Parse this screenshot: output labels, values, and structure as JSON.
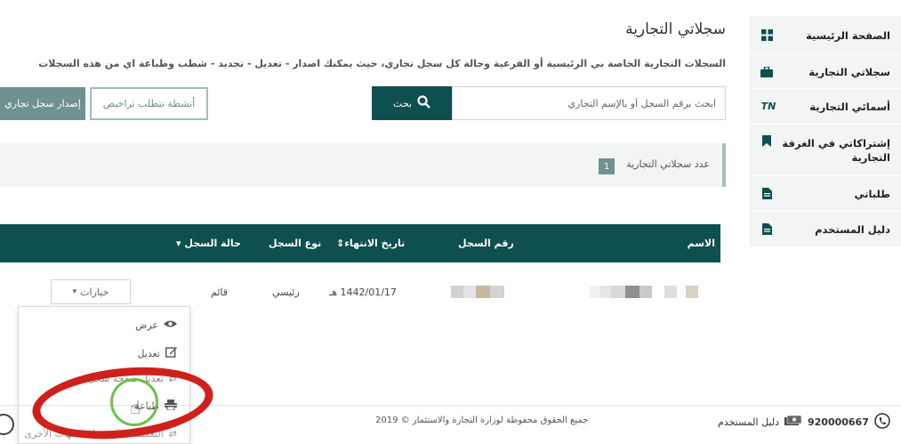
{
  "sidebar": {
    "items": [
      {
        "label": "الصفحة الرئيسية",
        "icon": "grid-icon"
      },
      {
        "label": "سجلاتي التجارية",
        "icon": "briefcase-icon"
      },
      {
        "label": "أسمائي التجارية",
        "icon": "tn-icon",
        "icon_text": "TN"
      },
      {
        "label": "إشتراكاتي في الغرفة التجارية",
        "icon": "bookmark-icon"
      },
      {
        "label": "طلباتي",
        "icon": "document-icon"
      },
      {
        "label": "دليل المستخدم",
        "icon": "document-icon"
      }
    ]
  },
  "main": {
    "title": "سجلاتي التجارية",
    "description": "السجلات التجارية الخاصة بي الرئيسية أو الفرعية وحالة كل سجل تجاري، حيث يمكنك اصدار - تعديل - تجديد - شطب وطباعة اي من هذه السجلات",
    "search": {
      "placeholder": "ابحث برقم السجل أو بالإسم التجاري",
      "button_label": "بحث"
    },
    "buttons": {
      "licenses": "أنشطة تتطلب تراخيص",
      "issue": "إصدار سجل تجاري"
    },
    "count": {
      "label": "عدد سجلاتي التجارية",
      "value": "1"
    }
  },
  "table": {
    "headers": {
      "name": "الاسم",
      "number": "رقم السجل",
      "expiry": "تاريخ الانتهاء",
      "type": "نوع السجل",
      "status": "حالة السجل"
    },
    "row": {
      "expiry": "1442/01/17 هـ",
      "type": "رئيسي",
      "status": "قائم"
    },
    "options_label": "خيارات",
    "menu": [
      {
        "label": "عرض",
        "icon": "eye-icon"
      },
      {
        "label": "تعديل",
        "icon": "edit-icon"
      },
      {
        "label": "تعديل صفحة سجل",
        "icon": "arrows-icon"
      },
      {
        "label": "طباعة",
        "icon": "print-icon"
      },
      {
        "label": "التعميمات المرسلة للجهات الأخرى",
        "icon": "exchange-icon"
      }
    ]
  },
  "footer": {
    "copyright": "جميع الحقوق محفوظة لوزارة التجارة والاستثمار © 2019",
    "phone": "920000667",
    "guide": "دليل المستخدم"
  },
  "colors": {
    "primary": "#0e4f4f",
    "secondary": "#6f9191",
    "sidebar_bg": "#f3f4f4",
    "annotation_red": "#d0201c",
    "annotation_green": "#6cc04a"
  }
}
